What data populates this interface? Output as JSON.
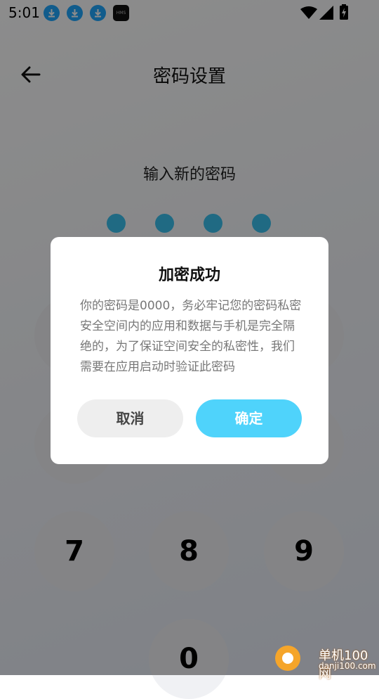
{
  "status_bar": {
    "time": "5:01",
    "hms_label": "HMS",
    "icons": [
      "download-icon",
      "download-icon",
      "download-icon",
      "hms-icon",
      "wifi-icon",
      "signal-icon",
      "battery-icon"
    ]
  },
  "header": {
    "title": "密码设置",
    "back_icon": "arrow-left-icon"
  },
  "pin": {
    "prompt": "输入新的密码",
    "filled_count": 4,
    "total": 4,
    "dot_color": "#3bc2ee"
  },
  "keypad": {
    "keys": [
      "7",
      "8",
      "9",
      "0"
    ]
  },
  "dialog": {
    "title": "加密成功",
    "message": "你的密码是0000，务必牢记您的密码私密安全空间内的应用和数据与手机是完全隔绝的，为了保证空间安全的私密性，我们需要在应用启动时验证此密码",
    "cancel_label": "取消",
    "confirm_label": "确定",
    "confirm_color": "#4fd3fb"
  },
  "watermark": {
    "text": "单机100网",
    "domain": "danji100.com"
  }
}
